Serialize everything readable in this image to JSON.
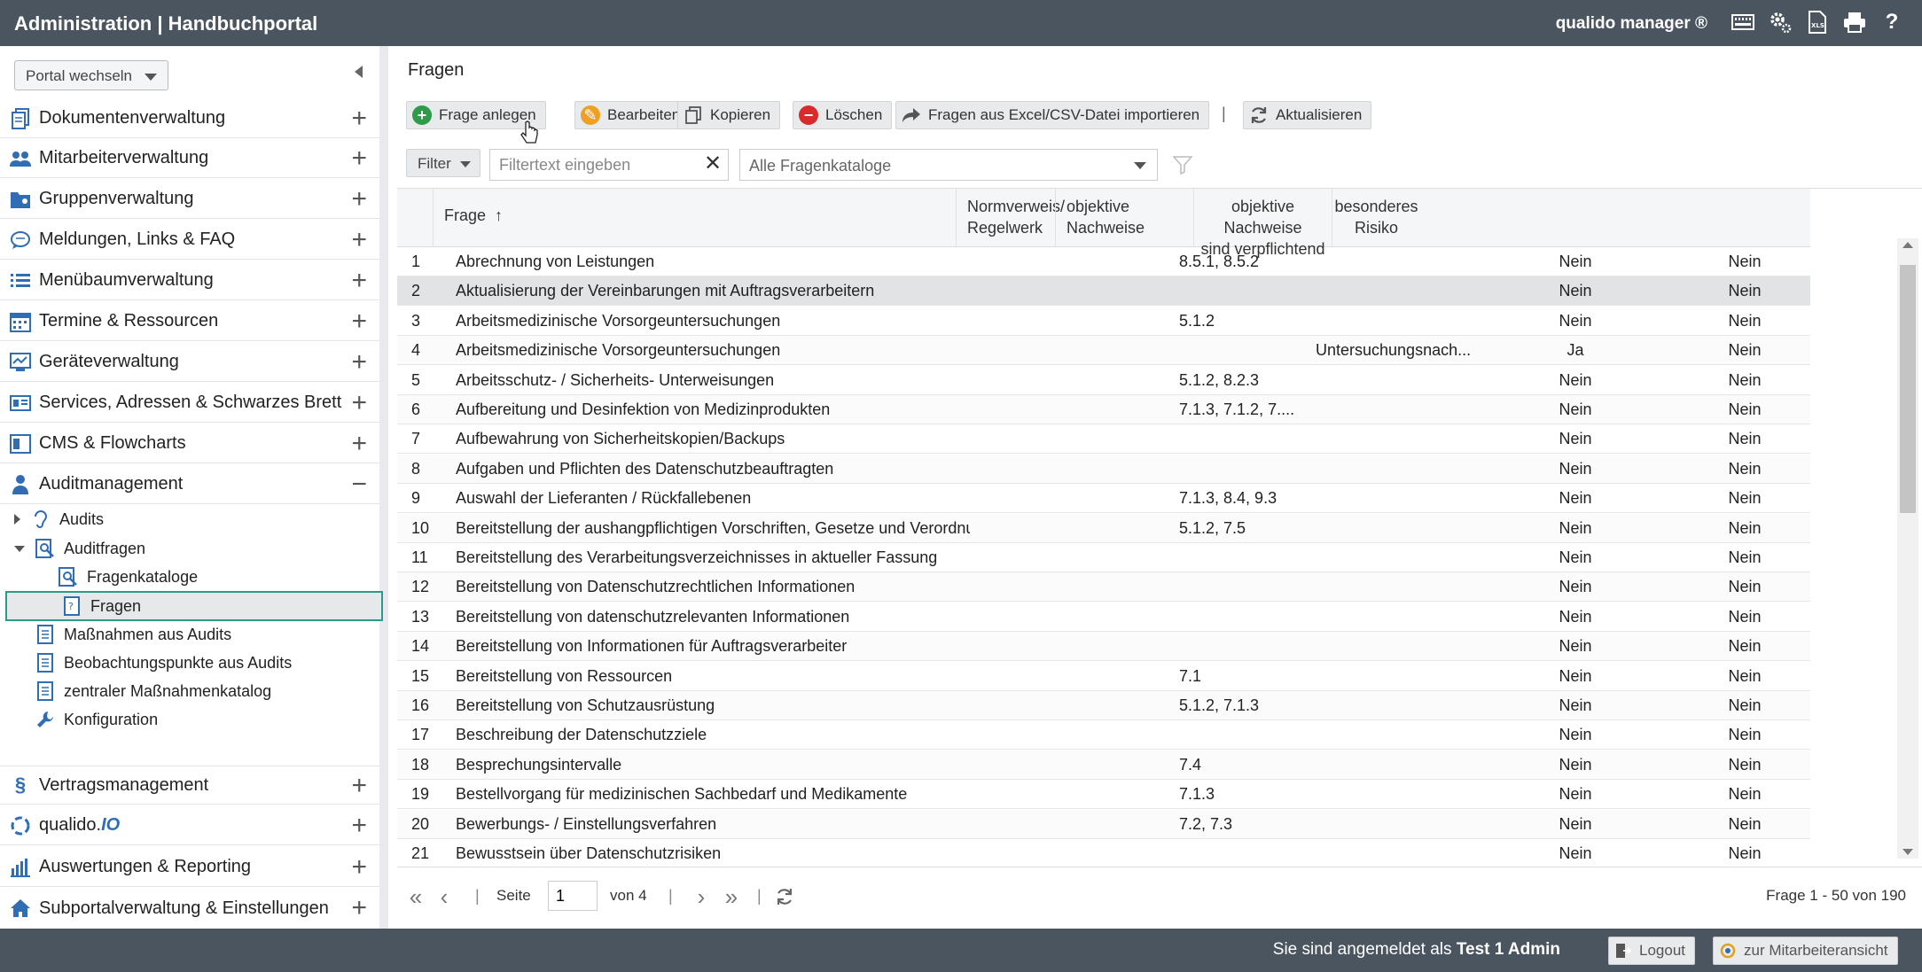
{
  "header": {
    "app_title": "Administration | Handbuchportal",
    "product": "qualido manager ®",
    "icons": [
      "keyboard-icon",
      "settings-icon",
      "file-icon",
      "print-icon",
      "help-icon"
    ]
  },
  "sidebar": {
    "portal_switch": "Portal wechseln",
    "groups": [
      {
        "label": "Dokumentenverwaltung",
        "icon": "documents-icon",
        "state": "+"
      },
      {
        "label": "Mitarbeiterverwaltung",
        "icon": "users-icon",
        "state": "+"
      },
      {
        "label": "Gruppenverwaltung",
        "icon": "groups-icon",
        "state": "+"
      },
      {
        "label": "Meldungen, Links & FAQ",
        "icon": "chat-icon",
        "state": "+"
      },
      {
        "label": "Menübaumverwaltung",
        "icon": "list-icon",
        "state": "+"
      },
      {
        "label": "Termine & Ressourcen",
        "icon": "calendar-icon",
        "state": "+"
      },
      {
        "label": "Geräteverwaltung",
        "icon": "device-icon",
        "state": "+"
      },
      {
        "label": "Services, Adressen & Schwarzes Brett",
        "icon": "board-icon",
        "state": "+"
      },
      {
        "label": "CMS & Flowcharts",
        "icon": "cms-icon",
        "state": "+"
      },
      {
        "label": "Auditmanagement",
        "icon": "auditor-icon",
        "state": "−"
      }
    ],
    "audit_items": {
      "audits": "Audits",
      "auditfragen": "Auditfragen",
      "fragenkataloge": "Fragenkataloge",
      "fragen": "Fragen",
      "massnahmen": "Maßnahmen aus Audits",
      "beobachtung": "Beobachtungspunkte aus Audits",
      "zentral": "zentraler Maßnahmenkatalog",
      "konfiguration": "Konfiguration"
    },
    "lower_groups": [
      {
        "label": "Vertragsmanagement",
        "icon": "paragraph-icon",
        "state": "+"
      },
      {
        "label": "qualido.",
        "suffix": "IO",
        "icon": "qualido-icon",
        "state": "+"
      },
      {
        "label": "Auswertungen & Reporting",
        "icon": "chart-icon",
        "state": "+"
      },
      {
        "label": "Subportalverwaltung & Einstellungen",
        "icon": "home-icon",
        "state": "+"
      }
    ]
  },
  "main": {
    "title": "Fragen",
    "toolbar": {
      "create": "Frage anlegen",
      "edit": "Bearbeiten",
      "copy": "Kopieren",
      "delete": "Löschen",
      "import": "Fragen aus Excel/CSV-Datei importieren",
      "separator": "|",
      "refresh": "Aktualisieren"
    },
    "filter": {
      "button": "Filter",
      "placeholder": "Filtertext eingeben",
      "catalog": "Alle Fragenkataloge"
    },
    "columns": {
      "frage": "Frage",
      "sort_icon": "↑",
      "norm_1": "Normverweis/",
      "norm_2": "Regelwerk",
      "obj_1": "objektive",
      "obj_2": "Nachweise",
      "pflicht_1": "objektive Nachweise",
      "pflicht_2": "sind verpflichtend",
      "risk_1": "besonderes",
      "risk_2": "Risiko"
    },
    "rows": [
      {
        "no": "1",
        "frage": "Abrechnung von Leistungen",
        "norm": "8.5.1, 8.5.2",
        "obj": "",
        "pflicht": "Nein",
        "risiko": "Nein"
      },
      {
        "no": "2",
        "frage": "Aktualisierung der Vereinbarungen mit Auftragsverarbeitern",
        "norm": "",
        "obj": "",
        "pflicht": "Nein",
        "risiko": "Nein"
      },
      {
        "no": "3",
        "frage": "Arbeitsmedizinische Vorsorgeuntersuchungen",
        "norm": "5.1.2",
        "obj": "",
        "pflicht": "Nein",
        "risiko": "Nein"
      },
      {
        "no": "4",
        "frage": "Arbeitsmedizinische Vorsorgeuntersuchungen",
        "norm": "",
        "obj": "Untersuchungsnach...",
        "pflicht": "Ja",
        "risiko": "Nein"
      },
      {
        "no": "5",
        "frage": "Arbeitsschutz- / Sicherheits- Unterweisungen",
        "norm": "5.1.2, 8.2.3",
        "obj": "",
        "pflicht": "Nein",
        "risiko": "Nein"
      },
      {
        "no": "6",
        "frage": "Aufbereitung und Desinfektion von Medizinprodukten",
        "norm": "7.1.3, 7.1.2, 7....",
        "obj": "",
        "pflicht": "Nein",
        "risiko": "Nein"
      },
      {
        "no": "7",
        "frage": "Aufbewahrung von Sicherheitskopien/Backups",
        "norm": "",
        "obj": "",
        "pflicht": "Nein",
        "risiko": "Nein"
      },
      {
        "no": "8",
        "frage": "Aufgaben und Pflichten des Datenschutzbeauftragten",
        "norm": "",
        "obj": "",
        "pflicht": "Nein",
        "risiko": "Nein"
      },
      {
        "no": "9",
        "frage": "Auswahl der Lieferanten / Rückfallebenen",
        "norm": "7.1.3, 8.4, 9.3",
        "obj": "",
        "pflicht": "Nein",
        "risiko": "Nein"
      },
      {
        "no": "10",
        "frage": "Bereitstellung der aushangpflichtigen Vorschriften, Gesetze und Verordnungen",
        "norm": "5.1.2, 7.5",
        "obj": "",
        "pflicht": "Nein",
        "risiko": "Nein"
      },
      {
        "no": "11",
        "frage": "Bereitstellung des Verarbeitungsverzeichnisses in aktueller Fassung",
        "norm": "",
        "obj": "",
        "pflicht": "Nein",
        "risiko": "Nein"
      },
      {
        "no": "12",
        "frage": "Bereitstellung von Datenschutzrechtlichen Informationen",
        "norm": "",
        "obj": "",
        "pflicht": "Nein",
        "risiko": "Nein"
      },
      {
        "no": "13",
        "frage": "Bereitstellung von datenschutzrelevanten Informationen",
        "norm": "",
        "obj": "",
        "pflicht": "Nein",
        "risiko": "Nein"
      },
      {
        "no": "14",
        "frage": "Bereitstellung von Informationen für Auftragsverarbeiter",
        "norm": "",
        "obj": "",
        "pflicht": "Nein",
        "risiko": "Nein"
      },
      {
        "no": "15",
        "frage": "Bereitstellung von Ressourcen",
        "norm": "7.1",
        "obj": "",
        "pflicht": "Nein",
        "risiko": "Nein"
      },
      {
        "no": "16",
        "frage": "Bereitstellung von Schutzausrüstung",
        "norm": "5.1.2, 7.1.3",
        "obj": "",
        "pflicht": "Nein",
        "risiko": "Nein"
      },
      {
        "no": "17",
        "frage": "Beschreibung der Datenschutzziele",
        "norm": "",
        "obj": "",
        "pflicht": "Nein",
        "risiko": "Nein"
      },
      {
        "no": "18",
        "frage": "Besprechungsintervalle",
        "norm": "7.4",
        "obj": "",
        "pflicht": "Nein",
        "risiko": "Nein"
      },
      {
        "no": "19",
        "frage": "Bestellvorgang für medizinischen Sachbedarf und Medikamente",
        "norm": "7.1.3",
        "obj": "",
        "pflicht": "Nein",
        "risiko": "Nein"
      },
      {
        "no": "20",
        "frage": "Bewerbungs- / Einstellungsverfahren",
        "norm": "7.2, 7.3",
        "obj": "",
        "pflicht": "Nein",
        "risiko": "Nein"
      },
      {
        "no": "21",
        "frage": "Bewusstsein über Datenschutzrisiken",
        "norm": "",
        "obj": "",
        "pflicht": "Nein",
        "risiko": "Nein"
      }
    ],
    "selected_row": "2",
    "pager": {
      "page_label": "Seite",
      "page_value": "1",
      "of": "von 4",
      "summary": "Frage 1 - 50 von 190"
    }
  },
  "footer": {
    "logged_in_prefix": "Sie sind angemeldet als",
    "user": "Test 1 Admin",
    "logout": "Logout",
    "employee_view": "zur Mitarbeiteransicht"
  },
  "colors": {
    "header_bg": "#4b555f",
    "accent_blue": "#2f6db4",
    "selection_border": "#2a9a8a",
    "create_green": "#2e9a4a",
    "edit_orange": "#f0a020",
    "delete_red": "#d92b2b"
  }
}
